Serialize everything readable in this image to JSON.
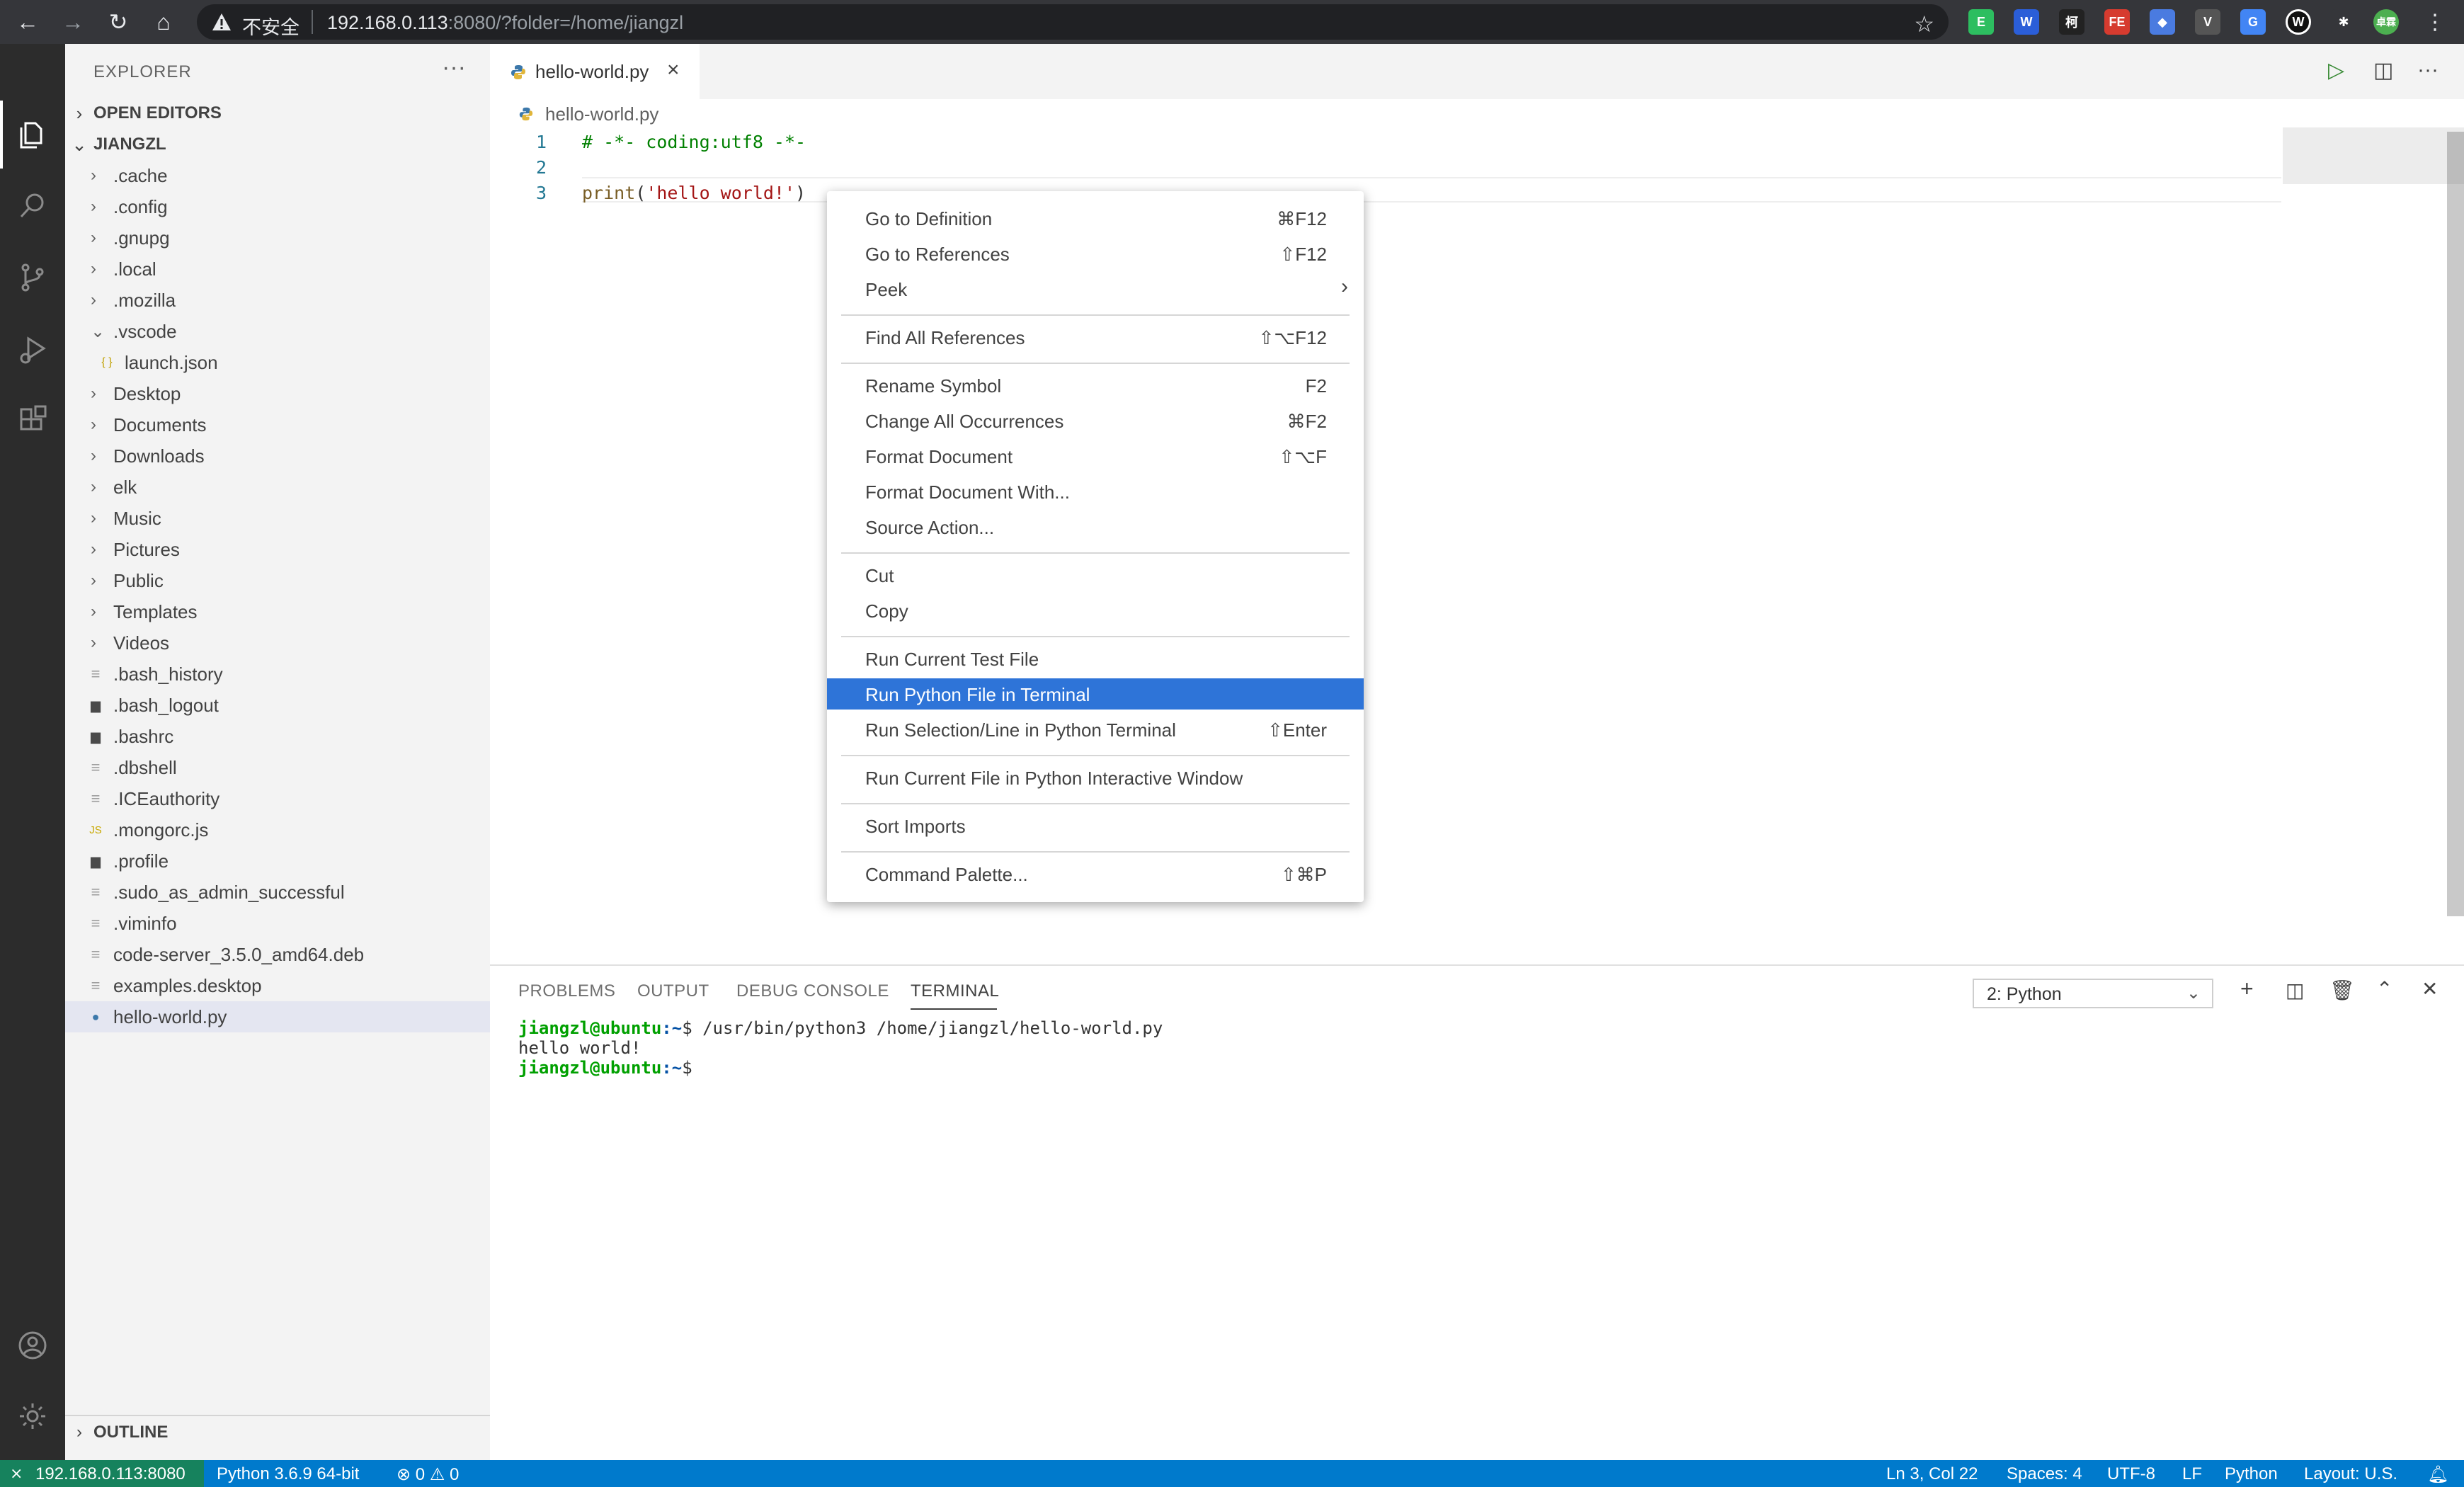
{
  "browser": {
    "insecure_label": "不安全",
    "url_host": "192.168.0.113",
    "url_rest": ":8080/?folder=/home/jiangzl",
    "extensions": [
      {
        "name": "evernote-extension",
        "label": "E",
        "color": "#2dbe60"
      },
      {
        "name": "w-extension",
        "label": "W",
        "color": "#2b5ed8"
      },
      {
        "name": "ke-extension",
        "label": "柯",
        "color": "#222222"
      },
      {
        "name": "fe-extension",
        "label": "FE",
        "color": "#d63b2f"
      },
      {
        "name": "gem-extension",
        "label": "◆",
        "color": "#4a7be0"
      },
      {
        "name": "v-extension",
        "label": "V",
        "color": "#555555"
      },
      {
        "name": "translate-extension",
        "label": "G",
        "color": "#4285f4"
      },
      {
        "name": "w-circle-extension",
        "label": "W",
        "color": "#111111"
      },
      {
        "name": "puzzle-extension",
        "label": "✱",
        "color": "#35363a"
      },
      {
        "name": "profile-avatar",
        "label": "卓霖",
        "color": "#4caf50"
      }
    ]
  },
  "sidebar": {
    "title": "EXPLORER",
    "open_editors": "OPEN EDITORS",
    "workspace": "JIANGZL",
    "outline": "OUTLINE",
    "items": [
      {
        "label": ".cache",
        "kind": "folder"
      },
      {
        "label": ".config",
        "kind": "folder"
      },
      {
        "label": ".gnupg",
        "kind": "folder"
      },
      {
        "label": ".local",
        "kind": "folder"
      },
      {
        "label": ".mozilla",
        "kind": "folder"
      },
      {
        "label": ".vscode",
        "kind": "folder-open"
      },
      {
        "label": "launch.json",
        "kind": "json"
      },
      {
        "label": "Desktop",
        "kind": "folder"
      },
      {
        "label": "Documents",
        "kind": "folder"
      },
      {
        "label": "Downloads",
        "kind": "folder"
      },
      {
        "label": "elk",
        "kind": "folder"
      },
      {
        "label": "Music",
        "kind": "folder"
      },
      {
        "label": "Pictures",
        "kind": "folder"
      },
      {
        "label": "Public",
        "kind": "folder"
      },
      {
        "label": "Templates",
        "kind": "folder"
      },
      {
        "label": "Videos",
        "kind": "folder"
      },
      {
        "label": ".bash_history",
        "kind": "text"
      },
      {
        "label": ".bash_logout",
        "kind": "shell"
      },
      {
        "label": ".bashrc",
        "kind": "shell"
      },
      {
        "label": ".dbshell",
        "kind": "text"
      },
      {
        "label": ".ICEauthority",
        "kind": "text"
      },
      {
        "label": ".mongorc.js",
        "kind": "js"
      },
      {
        "label": ".profile",
        "kind": "shell"
      },
      {
        "label": ".sudo_as_admin_successful",
        "kind": "text"
      },
      {
        "label": ".viminfo",
        "kind": "text"
      },
      {
        "label": "code-server_3.5.0_amd64.deb",
        "kind": "text"
      },
      {
        "label": "examples.desktop",
        "kind": "text"
      },
      {
        "label": "hello-world.py",
        "kind": "python",
        "selected": true
      }
    ]
  },
  "editor": {
    "tab_label": "hello-world.py",
    "breadcrumb": "hello-world.py",
    "lines": [
      {
        "num": "1",
        "parts": [
          {
            "t": "# -*- coding:utf8 -*-",
            "c": "comment"
          }
        ]
      },
      {
        "num": "2",
        "parts": []
      },
      {
        "num": "3",
        "parts": [
          {
            "t": "print",
            "c": "fn"
          },
          {
            "t": "(",
            "c": ""
          },
          {
            "t": "'hello world!'",
            "c": "str"
          },
          {
            "t": ")",
            "c": ""
          }
        ]
      }
    ]
  },
  "context_menu": {
    "groups": [
      [
        {
          "label": "Go to Definition",
          "key": "⌘F12"
        },
        {
          "label": "Go to References",
          "key": "⇧F12"
        },
        {
          "label": "Peek",
          "key": "›"
        }
      ],
      [
        {
          "label": "Find All References",
          "key": "⇧⌥F12"
        }
      ],
      [
        {
          "label": "Rename Symbol",
          "key": "F2"
        },
        {
          "label": "Change All Occurrences",
          "key": "⌘F2"
        },
        {
          "label": "Format Document",
          "key": "⇧⌥F"
        },
        {
          "label": "Format Document With...",
          "key": ""
        },
        {
          "label": "Source Action...",
          "key": ""
        }
      ],
      [
        {
          "label": "Cut",
          "key": ""
        },
        {
          "label": "Copy",
          "key": ""
        }
      ],
      [
        {
          "label": "Run Current Test File",
          "key": ""
        },
        {
          "label": "Run Python File in Terminal",
          "key": "",
          "highlighted": true
        },
        {
          "label": "Run Selection/Line in Python Terminal",
          "key": "⇧Enter"
        }
      ],
      [
        {
          "label": "Run Current File in Python Interactive Window",
          "key": ""
        }
      ],
      [
        {
          "label": "Sort Imports",
          "key": ""
        }
      ],
      [
        {
          "label": "Command Palette...",
          "key": "⇧⌘P"
        }
      ]
    ]
  },
  "panel": {
    "tabs": [
      "PROBLEMS",
      "OUTPUT",
      "DEBUG CONSOLE",
      "TERMINAL"
    ],
    "active_tab": "TERMINAL",
    "terminal_select": "2: Python",
    "terminal": {
      "user": "jiangzl@ubuntu",
      "path": ":~",
      "command": "$ /usr/bin/python3 /home/jiangzl/hello-world.py",
      "output": "hello world!",
      "prompt_end": "$"
    }
  },
  "statusbar": {
    "remote": "192.168.0.113:8080",
    "interpreter": "Python 3.6.9 64-bit",
    "errors": "0",
    "warnings": "0",
    "position": "Ln 3, Col 22",
    "spaces": "Spaces: 4",
    "encoding": "UTF-8",
    "eol": "LF",
    "language": "Python",
    "layout": "Layout: U.S."
  }
}
